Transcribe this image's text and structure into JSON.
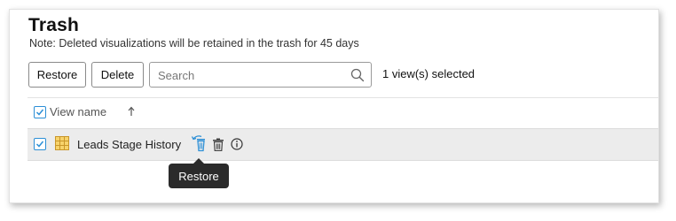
{
  "page": {
    "title": "Trash",
    "note": "Note: Deleted visualizations will be retained in the trash for 45 days"
  },
  "toolbar": {
    "restore_label": "Restore",
    "delete_label": "Delete",
    "search_placeholder": "Search",
    "selected_text": "1 view(s) selected"
  },
  "table": {
    "header_label": "View name",
    "rows": [
      {
        "name": "Leads Stage History",
        "checked": true
      }
    ]
  },
  "tooltip": {
    "text": "Restore"
  },
  "colors": {
    "accent": "#2c8fd6",
    "table_icon": "#e8b84a",
    "tooltip_bg": "#2b2b2b"
  },
  "icons": {
    "search": "search-icon",
    "sort": "sort-ascending-icon",
    "table": "table-icon",
    "restore": "restore-icon",
    "delete": "trash-icon",
    "info": "info-icon"
  }
}
